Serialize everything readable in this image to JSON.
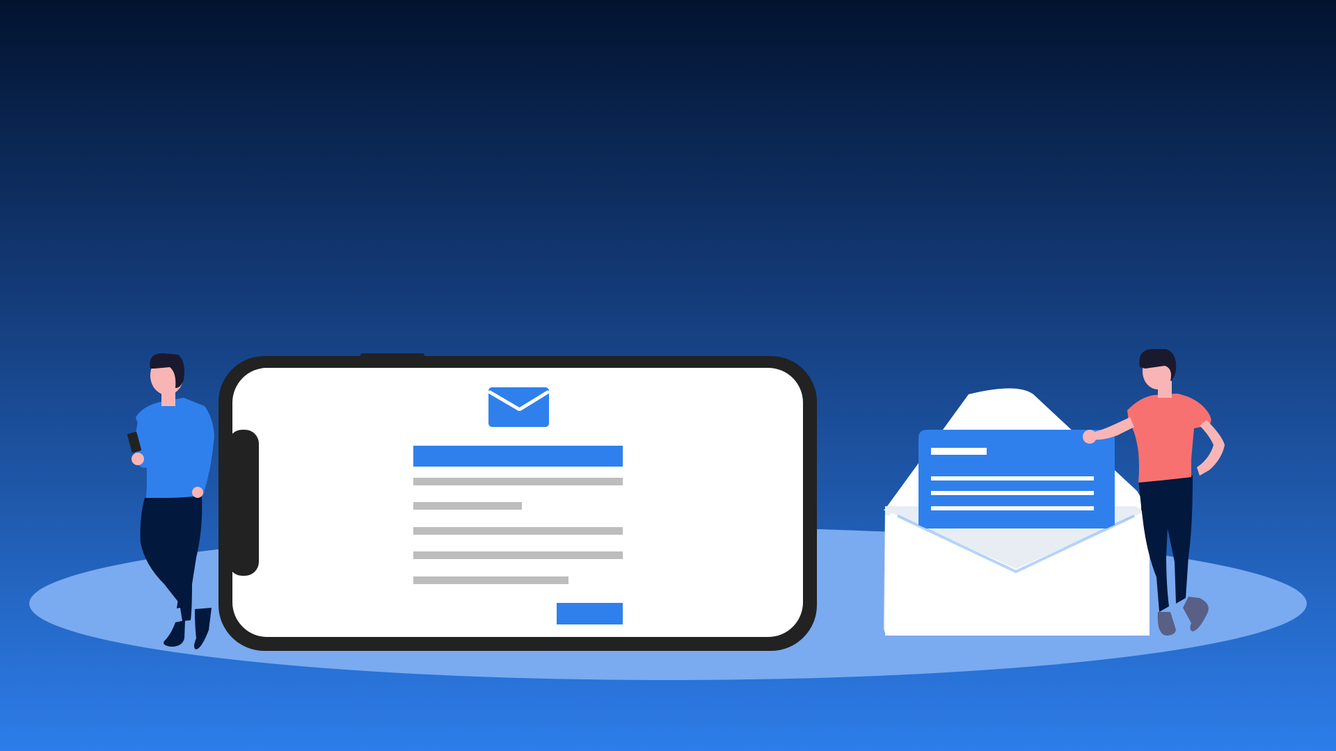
{
  "scene": {
    "kind": "illustration",
    "subject": "email-newsletter",
    "text_visible": false
  },
  "colors": {
    "background_top": "#02132F",
    "background_bottom": "#2D7DEA",
    "platform": "#7AAAF0",
    "accent_blue": "#2F80ED",
    "phone_frame": "#222222",
    "screen": "#FFFFFF",
    "text_line_gray": "#BDBDBD",
    "envelope": "#FFFFFF",
    "letter": "#2F80ED",
    "skin": "#F9B5B5",
    "hair": "#1A1A2E",
    "pants": "#02183D",
    "shirt_left": "#2F80ED",
    "shirt_right": "#F87171",
    "shoe_right": "#5A5F85"
  },
  "phone": {
    "orientation": "landscape",
    "email_icon": "envelope-icon",
    "heading_bar": "filled",
    "text_lines": 5,
    "text_line_fractions": [
      1.0,
      0.52,
      1.0,
      1.0,
      0.75
    ],
    "action_button": "filled"
  },
  "envelope": {
    "state": "open",
    "letter_lines": 4
  },
  "people": [
    {
      "role": "man-holding-phone",
      "position": "left",
      "shirt": "blue"
    },
    {
      "role": "man-leaning-on-envelope",
      "position": "right",
      "shirt": "coral"
    }
  ]
}
